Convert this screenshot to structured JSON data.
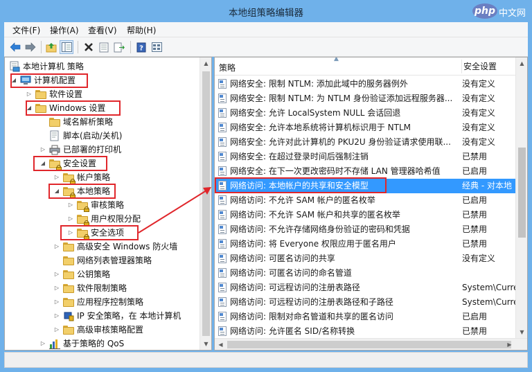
{
  "window": {
    "title": "本地组策略编辑器",
    "watermark_logo": "php",
    "watermark_site": "中文网"
  },
  "menu": {
    "file": "文件(F)",
    "action": "操作(A)",
    "view": "查看(V)",
    "help": "帮助(H)"
  },
  "toolbar": {
    "icons": [
      "back-arrow-icon",
      "forward-arrow-icon",
      "up-folder-icon",
      "show-hide-tree-icon",
      "delete-icon",
      "properties-icon",
      "export-list-icon",
      "help-icon",
      "view-icon"
    ]
  },
  "tree": {
    "root": "本地计算机 策略",
    "computer_config": "计算机配置",
    "software_settings": "软件设置",
    "windows_settings": "Windows 设置",
    "name_resolution": "域名解析策略",
    "scripts": "脚本(启动/关机)",
    "printers": "已部署的打印机",
    "security_settings": "安全设置",
    "account_policies": "帐户策略",
    "local_policies": "本地策略",
    "audit_policy": "审核策略",
    "user_rights": "用户权限分配",
    "security_options": "安全选项",
    "firewall": "高级安全 Windows 防火墙",
    "network_list": "网络列表管理器策略",
    "public_key": "公钥策略",
    "software_restriction": "软件限制策略",
    "app_control": "应用程序控制策略",
    "ipsec": "IP 安全策略，在 本地计算机",
    "advanced_audit": "高级审核策略配置",
    "qos": "基于策略的 QoS"
  },
  "list": {
    "col_policy": "策略",
    "col_setting": "安全设置",
    "rows": [
      {
        "policy": "网络安全: 限制 NTLM: 添加此域中的服务器例外",
        "setting": "没有定义"
      },
      {
        "policy": "网络安全: 限制 NTLM: 为 NTLM 身份验证添加远程服务器...",
        "setting": "没有定义"
      },
      {
        "policy": "网络安全: 允许 LocalSystem NULL 会话回退",
        "setting": "没有定义"
      },
      {
        "policy": "网络安全: 允许本地系统将计算机标识用于 NTLM",
        "setting": "没有定义"
      },
      {
        "policy": "网络安全: 允许对此计算机的 PKU2U 身份验证请求使用联...",
        "setting": "没有定义"
      },
      {
        "policy": "网络安全: 在超过登录时间后强制注销",
        "setting": "已禁用"
      },
      {
        "policy": "网络安全: 在下一次更改密码时不存储 LAN 管理器哈希值",
        "setting": "已启用"
      },
      {
        "policy": "网络访问: 本地帐户的共享和安全模型",
        "setting": "经典 - 对本地"
      },
      {
        "policy": "网络访问: 不允许 SAM 帐户的匿名枚举",
        "setting": "已启用"
      },
      {
        "policy": "网络访问: 不允许 SAM 帐户和共享的匿名枚举",
        "setting": "已禁用"
      },
      {
        "policy": "网络访问: 不允许存储网络身份验证的密码和凭据",
        "setting": "已禁用"
      },
      {
        "policy": "网络访问: 将 Everyone 权限应用于匿名用户",
        "setting": "已禁用"
      },
      {
        "policy": "网络访问: 可匿名访问的共享",
        "setting": "没有定义"
      },
      {
        "policy": "网络访问: 可匿名访问的命名管道",
        "setting": ""
      },
      {
        "policy": "网络访问: 可远程访问的注册表路径",
        "setting": "System\\Curre"
      },
      {
        "policy": "网络访问: 可远程访问的注册表路径和子路径",
        "setting": "System\\Curre"
      },
      {
        "policy": "网络访问: 限制对命名管道和共享的匿名访问",
        "setting": "已启用"
      },
      {
        "policy": "网络访问: 允许匿名 SID/名称转换",
        "setting": "已禁用"
      }
    ]
  },
  "colors": {
    "frame": "#6fb1ea",
    "selection": "#3399ff",
    "highlight_box": "#e0262b"
  }
}
